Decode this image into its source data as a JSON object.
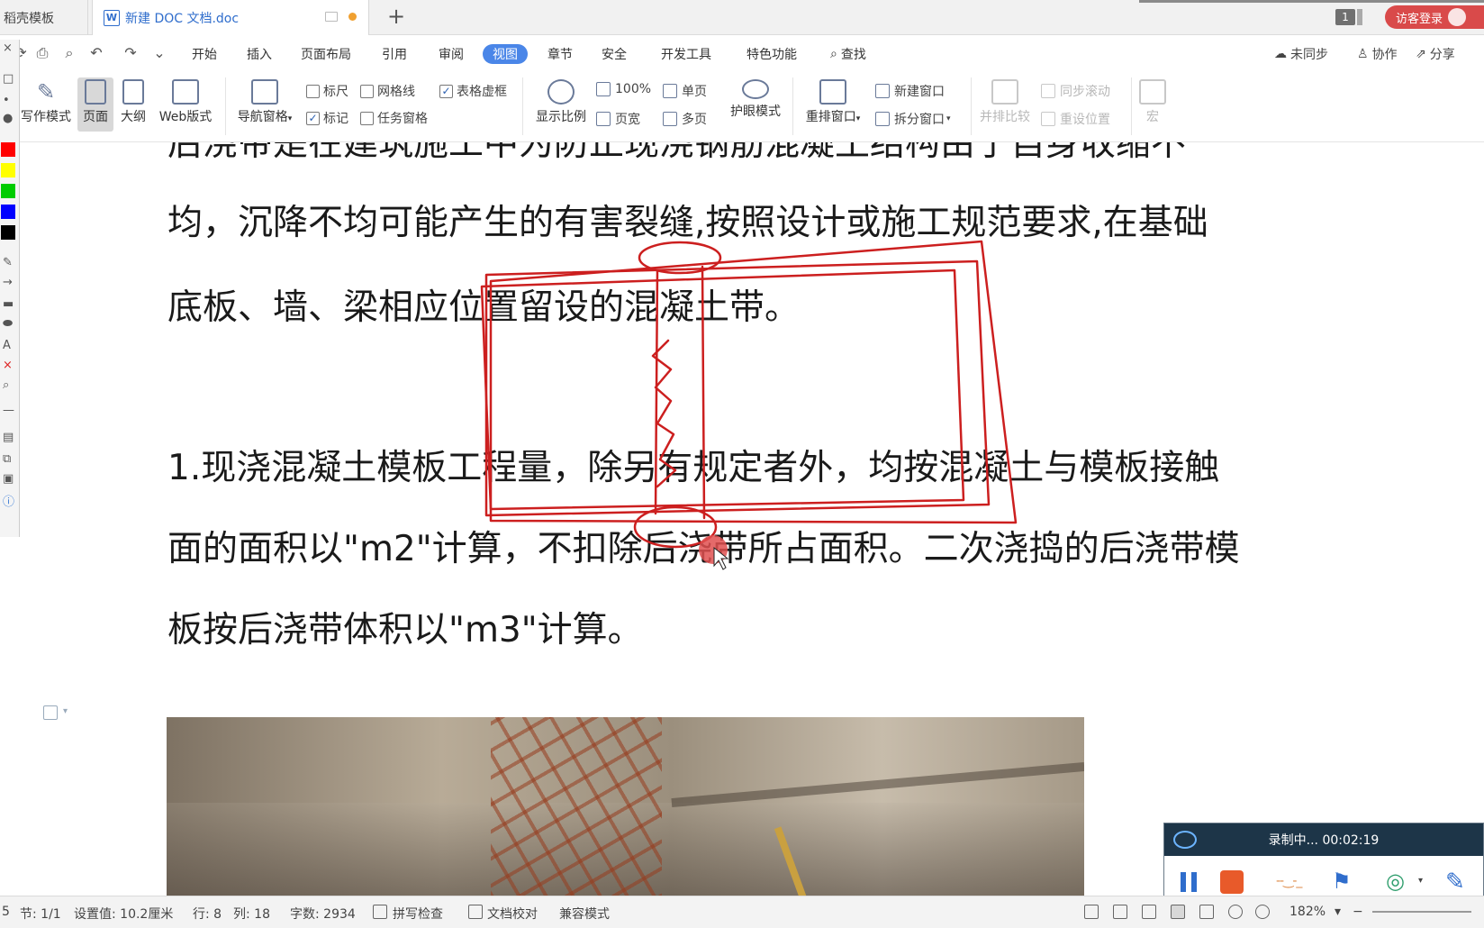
{
  "tabs": {
    "template_tab": "稻壳模板",
    "doc_tab": "新建 DOC 文档.doc",
    "doc_icon": "W",
    "new_tab": "+",
    "window_count": "1",
    "login": "访客登录"
  },
  "menu": {
    "items": [
      "开始",
      "插入",
      "页面布局",
      "引用",
      "审阅",
      "视图",
      "章节",
      "安全",
      "开发工具",
      "特色功能"
    ],
    "active": "视图",
    "search": "查找",
    "right": {
      "sync": "未同步",
      "collab": "协作",
      "share": "分享"
    }
  },
  "ribbon": {
    "write_mode": "写作模式",
    "page": "页面",
    "outline": "大纲",
    "web_layout": "Web版式",
    "nav_pane": "导航窗格",
    "checks": {
      "ruler": "标尺",
      "gridlines": "网格线",
      "table_gridlines": "表格虚框",
      "markup": "标记",
      "task_pane": "任务窗格"
    },
    "zoom": "显示比例",
    "zoom_100": "100%",
    "page_width": "页宽",
    "single_page": "单页",
    "multi_page": "多页",
    "eye_mode": "护眼模式",
    "rearrange": "重排窗口",
    "new_window": "新建窗口",
    "split_window": "拆分窗口",
    "side_by_side": "并排比较",
    "sync_scroll": "同步滚动",
    "reset_pos": "重设位置",
    "macro": "宏"
  },
  "document": {
    "line1": "后浇带是在建筑施工中为防止现浇钢筋混凝土结构由于自身收缩不",
    "line2": "均，沉降不均可能产生的有害裂缝,按照设计或施工规范要求,在基础",
    "line3": "底板、墙、梁相应位置留设的混凝土带。",
    "line4": "1.现浇混凝土模板工程量，除另有规定者外，均按混凝土与模板接触",
    "line5": "面的面积以\"m2\"计算，不扣除后浇带所占面积。二次浇捣的后浇带模",
    "line6": "板按后浇带体积以\"m3\"计算。"
  },
  "recorder": {
    "status": "录制中... 00:02:19"
  },
  "statusbar": {
    "page_prefix": "5",
    "section": "节: 1/1",
    "setting": "设置值: 10.2厘米",
    "row": "行: 8",
    "col": "列: 18",
    "word_count": "字数: 2934",
    "spell_check": "拼写检查",
    "doc_proof": "文档校对",
    "compat_mode": "兼容模式",
    "zoom": "182%"
  },
  "colors": {
    "accent": "#4a86e8",
    "annotation": "#cc1f1f",
    "login": "#d94a4a",
    "recorder_bar": "#1d3548"
  }
}
